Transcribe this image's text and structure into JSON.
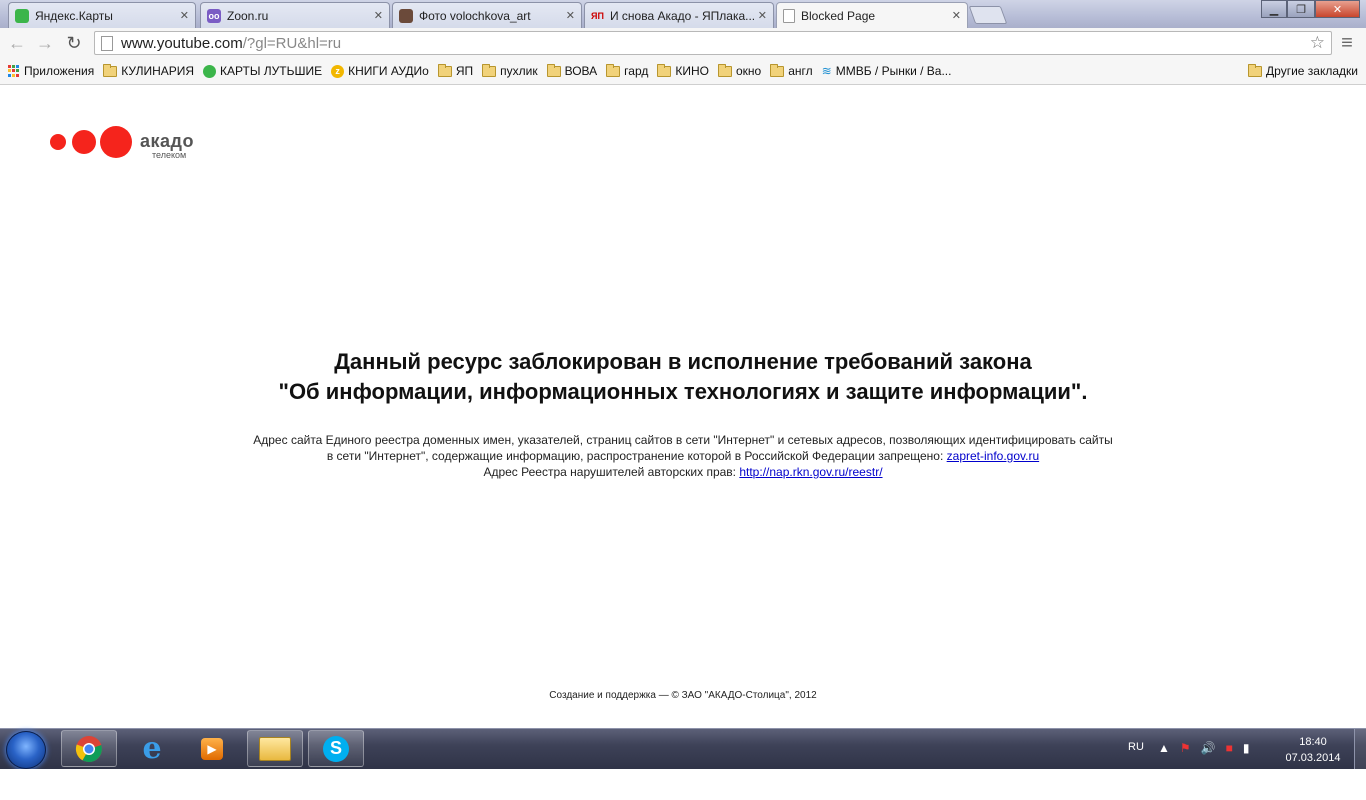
{
  "tabs": [
    {
      "title": "Яндекс.Карты",
      "favicon": "yandex-maps-icon",
      "color": "#3bb54a"
    },
    {
      "title": "Zoon.ru",
      "favicon": "zoon-icon",
      "color": "#7a5cc4"
    },
    {
      "title": "Фото volochkova_art",
      "favicon": "instagram-icon",
      "color": "#6b4a3a"
    },
    {
      "title": "И снова Акадо - ЯПлака...",
      "favicon": "yap-icon",
      "color": "#cc0000",
      "badge": "ЯП"
    },
    {
      "title": "Blocked Page",
      "favicon": "page-icon",
      "color": "#ffffff",
      "active": true
    }
  ],
  "toolbar": {
    "url_host": "www.youtube.com",
    "url_path": "/?gl=RU&hl=ru"
  },
  "bookmarks": {
    "apps_label": "Приложения",
    "items": [
      {
        "label": "КУЛИНАРИЯ",
        "icon": "folder-icon"
      },
      {
        "label": "КАРТЫ ЛУТЬШИЕ",
        "icon": "yandex-maps-icon"
      },
      {
        "label": "КНИГИ АУДИо",
        "icon": "z-icon"
      },
      {
        "label": "ЯП",
        "icon": "folder-icon"
      },
      {
        "label": "пухлик",
        "icon": "folder-icon"
      },
      {
        "label": "ВОВА",
        "icon": "folder-icon"
      },
      {
        "label": "гард",
        "icon": "folder-icon"
      },
      {
        "label": "КИНО",
        "icon": "folder-icon"
      },
      {
        "label": "окно",
        "icon": "folder-icon"
      },
      {
        "label": "англ",
        "icon": "folder-icon"
      },
      {
        "label": "ММВБ / Рынки / Ва...",
        "icon": "micex-icon"
      }
    ],
    "other_label": "Другие закладки"
  },
  "page": {
    "logo_text": "акадо",
    "logo_sub": "телеком",
    "logo_color": "#f5241c",
    "heading_line1": "Данный ресурс заблокирован в исполнение требований закона",
    "heading_line2": "\"Об информации, информационных технологиях и защите информации\".",
    "info_line1": "Адрес сайта Единого реестра доменных имен, указателей, страниц сайтов в сети \"Интернет\" и сетевых адресов, позволяющих идентифицировать сайты",
    "info_line2_prefix": "в сети \"Интернет\", содержащие информацию, распространение которой в Российской Федерации запрещено: ",
    "info_link1": "zapret-info.gov.ru",
    "info_line3_prefix": "Адрес Реестра нарушителей авторских прав: ",
    "info_link2": "http://nap.rkn.gov.ru/reestr/",
    "footer": "Создание и поддержка — © ЗАО \"АКАДО-Столица\", 2012"
  },
  "taskbar": {
    "apps": [
      "chrome-icon",
      "ie-icon",
      "media-player-icon",
      "explorer-icon",
      "skype-icon"
    ],
    "language": "RU",
    "time": "18:40",
    "date": "07.03.2014"
  }
}
